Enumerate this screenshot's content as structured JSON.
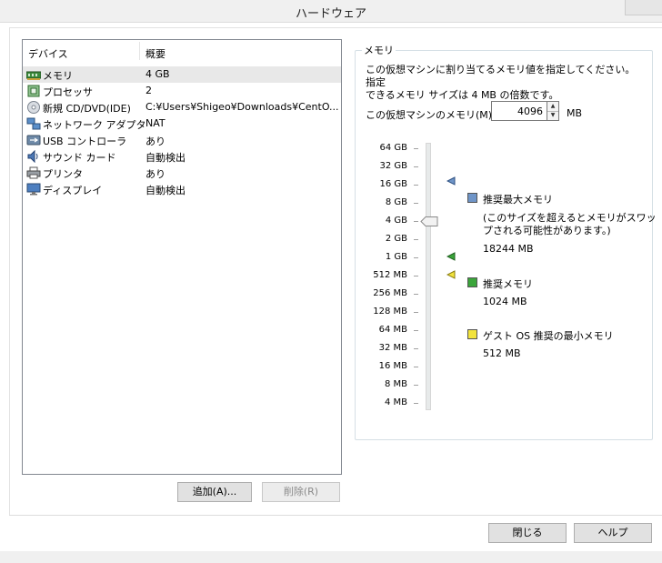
{
  "window": {
    "title": "ハードウェア"
  },
  "device_list": {
    "header_device": "デバイス",
    "header_summary": "概要",
    "items": [
      {
        "name": "メモリ",
        "summary": "4 GB",
        "icon": "memory-icon"
      },
      {
        "name": "プロセッサ",
        "summary": "2",
        "icon": "processor-icon"
      },
      {
        "name": "新規 CD/DVD(IDE)",
        "summary": "C:¥Users¥Shigeo¥Downloads¥CentO...",
        "icon": "cd-dvd-icon"
      },
      {
        "name": "ネットワーク アダプタ",
        "summary": "NAT",
        "icon": "network-adapter-icon"
      },
      {
        "name": "USB コントローラ",
        "summary": "あり",
        "icon": "usb-icon"
      },
      {
        "name": "サウンド カード",
        "summary": "自動検出",
        "icon": "sound-card-icon"
      },
      {
        "name": "プリンタ",
        "summary": "あり",
        "icon": "printer-icon"
      },
      {
        "name": "ディスプレイ",
        "summary": "自動検出",
        "icon": "display-icon"
      }
    ],
    "selected_index": 0
  },
  "buttons": {
    "add": "追加(A)...",
    "remove": "削除(R)",
    "close": "閉じる",
    "help": "ヘルプ"
  },
  "memory": {
    "group_label": "メモリ",
    "description_line1": "この仮想マシンに割り当てるメモリ値を指定してください。指定",
    "description_line2": "できるメモリ サイズは 4 MB の倍数です。",
    "field_label": "この仮想マシンのメモリ(M):",
    "value": "4096",
    "unit": "MB",
    "scale": [
      "64 GB",
      "32 GB",
      "16 GB",
      "8 GB",
      "4 GB",
      "2 GB",
      "1 GB",
      "512 MB",
      "256 MB",
      "128 MB",
      "64 MB",
      "32 MB",
      "16 MB",
      "8 MB",
      "4 MB"
    ],
    "slider_value": "4 GB",
    "legend": {
      "max_title": "推奨最大メモリ",
      "max_note_line1": "(このサイズを超えるとメモリがスワッ",
      "max_note_line2": "プされる可能性があります。)",
      "max_value": "18244 MB",
      "rec_title": "推奨メモリ",
      "rec_value": "1024 MB",
      "min_title": "ゲスト OS 推奨の最小メモリ",
      "min_value": "512 MB"
    },
    "colors": {
      "max": "#6f95c8",
      "recommended": "#3aa53a",
      "minimum": "#f2e33c"
    }
  }
}
